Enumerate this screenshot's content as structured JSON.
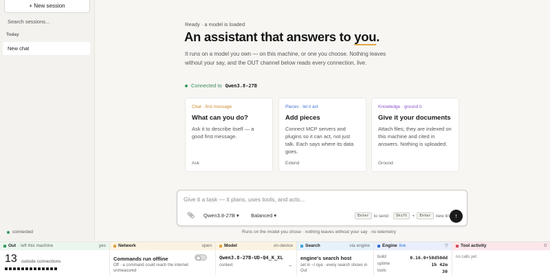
{
  "sidebar": {
    "new_session": "+ New session",
    "search_placeholder": "Search sessions...",
    "section": "Today",
    "items": [
      "New chat"
    ],
    "status": "connected"
  },
  "hero": {
    "status": "Ready · a model is loaded",
    "headline_pre": "An assistant that answers to ",
    "headline_em": "you",
    "headline_post": ".",
    "intro": "It runs on a model you own — on this machine, or one you choose. Nothing leaves without your say, and the OUT channel below reads every connection, live.",
    "connected_label": "Connected to",
    "connected_model": "Qwen3.8-27B"
  },
  "cards": [
    {
      "tag": "Chat · first message",
      "tag_color": "#d08a2e",
      "title": "What can you do?",
      "desc": "Ask it to describe itself — a good first message.",
      "foot": "Ask"
    },
    {
      "tag": "Pieces · let it act",
      "tag_color": "#3f6fd6",
      "title": "Add pieces",
      "desc": "Connect MCP servers and plugins so it can act, not just talk. Each says where its data goes.",
      "foot": "Extend"
    },
    {
      "tag": "Knowledge · ground it",
      "tag_color": "#8a4fc8",
      "title": "Give it your documents",
      "desc": "Attach files; they are indexed on this machine and cited in answers. Nothing is uploaded.",
      "foot": "Ground"
    }
  ],
  "composer": {
    "placeholder": "Give it a task — it plans, uses tools, and acts...",
    "model": "Qwen3.8-27B",
    "mode": "Balanced",
    "kbd_enter": "Enter",
    "to_send": "to send ·",
    "kbd_shift": "Shift",
    "plus": "+",
    "kbd_enter2": "Enter",
    "new_line": "new line",
    "footnote": "Runs on the model you chose · nothing leaves without your say · no telemetry"
  },
  "panels": {
    "out": {
      "name": "Out",
      "sub": "· left this machine",
      "right": "yes",
      "count": "13",
      "count_label": "outside connections",
      "color": "#2f9a58",
      "bg": "#eaf6ee"
    },
    "network": {
      "name": "Network",
      "right": "open",
      "title": "Commands run offline",
      "desc": "Off · a command could reach the internet unmeasured",
      "color": "#e0a040",
      "bg": "#fbf3e1"
    },
    "model": {
      "name": "Model",
      "right": "on-device",
      "id": "Qwen3.8-27B-UD-Q4_K_XL",
      "ctx": "context",
      "dash": "–",
      "color": "#e0a040",
      "bg": "#fbf3e1"
    },
    "search": {
      "name": "Search",
      "right": "via engine",
      "title": "engine's search host",
      "desc": "set in ~/.oya · every search shows in Out",
      "color": "#3aa0d8",
      "bg": "#e6f2fa"
    },
    "engine": {
      "name": "Engine",
      "sub": "live",
      "right": "▽",
      "rows": [
        {
          "k": "build",
          "v": "0.16.0+58d50dd"
        },
        {
          "k": "uptime",
          "v": "1h 42m"
        },
        {
          "k": "tools",
          "v": "30"
        }
      ],
      "color": "#2a6fd6",
      "bg": "#eaeefc"
    },
    "tools": {
      "name": "Tool activity",
      "right": "0",
      "empty": "no calls yet",
      "color": "#d04a5a",
      "bg": "#fbe6ea"
    }
  }
}
